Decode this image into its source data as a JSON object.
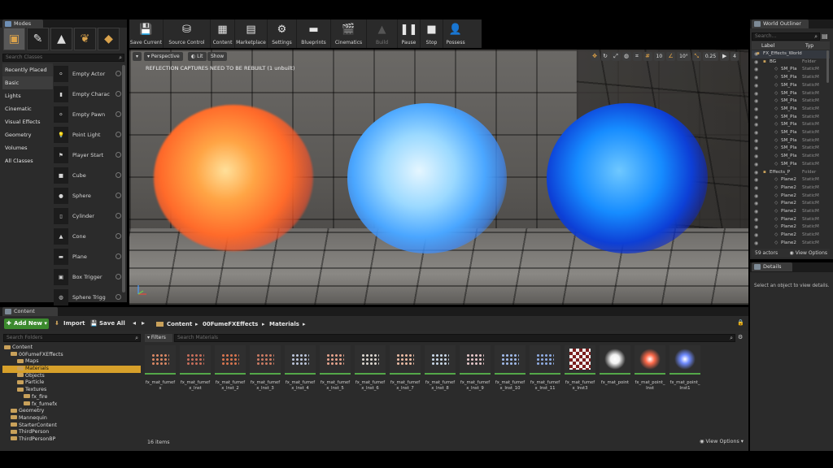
{
  "modes": {
    "tab_label": "Modes",
    "search_placeholder": "Search Classes",
    "categories": [
      "Recently Placed",
      "Basic",
      "Lights",
      "Cinematic",
      "Visual Effects",
      "Geometry",
      "Volumes",
      "All Classes"
    ],
    "actors": [
      "Empty Actor",
      "Empty Charac",
      "Empty Pawn",
      "Point Light",
      "Player Start",
      "Cube",
      "Sphere",
      "Cylinder",
      "Cone",
      "Plane",
      "Box Trigger",
      "Sphere Trigg"
    ]
  },
  "toolbar": {
    "buttons": [
      "Save Current",
      "Source Control",
      "Content",
      "Marketplace",
      "Settings",
      "Blueprints",
      "Cinematics",
      "Build",
      "Pause",
      "Stop",
      "Possess"
    ]
  },
  "viewport": {
    "perspective_label": "Perspective",
    "lit_label": "Lit",
    "show_label": "Show",
    "warning": "REFLECTION CAPTURES NEED TO BE REBUILT (1 unbuilt)",
    "grid_snap": "10",
    "rotation_snap": "10°",
    "scale_snap": "0.25",
    "camera_speed": "4"
  },
  "outliner": {
    "tab_label": "World Outliner",
    "search_placeholder": "Search...",
    "col_label": "Label",
    "col_type": "Typ",
    "rows": [
      {
        "label": "FX_Effects_World",
        "type": ""
      },
      {
        "label": "BG",
        "type": "Folder"
      },
      {
        "label": "SM_Pla",
        "type": "StaticM"
      },
      {
        "label": "SM_Pla",
        "type": "StaticM"
      },
      {
        "label": "SM_Pla",
        "type": "StaticM"
      },
      {
        "label": "SM_Pla",
        "type": "StaticM"
      },
      {
        "label": "SM_Pla",
        "type": "StaticM"
      },
      {
        "label": "SM_Pla",
        "type": "StaticM"
      },
      {
        "label": "SM_Pla",
        "type": "StaticM"
      },
      {
        "label": "SM_Pla",
        "type": "StaticM"
      },
      {
        "label": "SM_Pla",
        "type": "StaticM"
      },
      {
        "label": "SM_Pla",
        "type": "StaticM"
      },
      {
        "label": "SM_Pla",
        "type": "StaticM"
      },
      {
        "label": "SM_Pla",
        "type": "StaticM"
      },
      {
        "label": "SM_Pla",
        "type": "StaticM"
      },
      {
        "label": "Effects_P",
        "type": "Folder"
      },
      {
        "label": "Plane2",
        "type": "StaticM"
      },
      {
        "label": "Plane2",
        "type": "StaticM"
      },
      {
        "label": "Plane2",
        "type": "StaticM"
      },
      {
        "label": "Plane2",
        "type": "StaticM"
      },
      {
        "label": "Plane2",
        "type": "StaticM"
      },
      {
        "label": "Plane2",
        "type": "StaticM"
      },
      {
        "label": "Plane2",
        "type": "StaticM"
      },
      {
        "label": "Plane2",
        "type": "StaticM"
      },
      {
        "label": "Plane2",
        "type": "StaticM"
      }
    ],
    "actor_count": "59 actors",
    "view_options": "View Options"
  },
  "details": {
    "tab_label": "Details",
    "hint": "Select an object to view details."
  },
  "content_browser": {
    "tab_label": "Content Browser",
    "add_new": "Add New",
    "import": "Import",
    "save_all": "Save All",
    "breadcrumb": [
      "Content",
      "00FumeFXEffects",
      "Materials"
    ],
    "search_folders": "Search Folders",
    "filters": "Filters",
    "search_materials": "Search Materials",
    "tree": [
      {
        "label": "Content",
        "indent": 0
      },
      {
        "label": "00FumeFXEffects",
        "indent": 1
      },
      {
        "label": "Maps",
        "indent": 2
      },
      {
        "label": "Materials",
        "indent": 2
      },
      {
        "label": "Objects",
        "indent": 2
      },
      {
        "label": "Particle",
        "indent": 2
      },
      {
        "label": "Textures",
        "indent": 2
      },
      {
        "label": "fx_fire",
        "indent": 3
      },
      {
        "label": "fx_fumefx",
        "indent": 3
      },
      {
        "label": "Geometry",
        "indent": 1
      },
      {
        "label": "Mannequin",
        "indent": 1
      },
      {
        "label": "StarterContent",
        "indent": 1
      },
      {
        "label": "ThirdPerson",
        "indent": 1
      },
      {
        "label": "ThirdPersonBP",
        "indent": 1
      }
    ],
    "assets": [
      "fx_mat_fumefx",
      "fx_mat_fumefx_Inst",
      "fx_mat_fumefx_Inst_2",
      "fx_mat_fumefx_Inst_3",
      "fx_mat_fumefx_Inst_4",
      "fx_mat_fumefx_Inst_5",
      "fx_mat_fumefx_Inst_6",
      "fx_mat_fumefx_Inst_7",
      "fx_mat_fumefx_Inst_8",
      "fx_mat_fumefx_Inst_9",
      "fx_mat_fumefx_Inst_10",
      "fx_mat_fumefx_Inst_11",
      "fx_mat_fumefx_Inst3",
      "fx_mat_point",
      "fx_mat_point_Inst",
      "fx_mat_point_Inst1"
    ],
    "item_count": "16 items",
    "view_options": "View Options"
  }
}
